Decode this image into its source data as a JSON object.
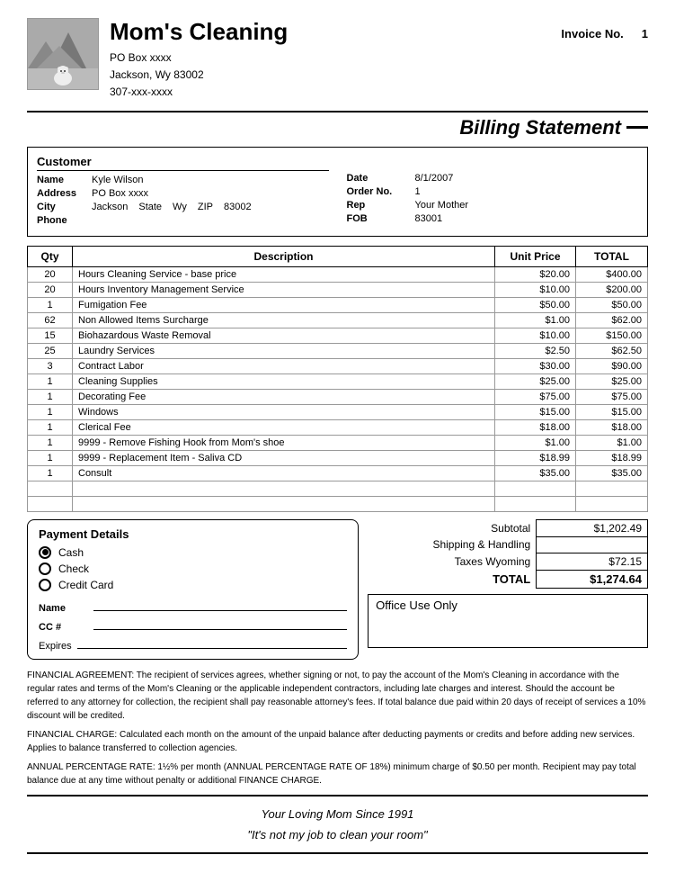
{
  "company": {
    "name": "Mom's Cleaning",
    "address_line1": "PO Box xxxx",
    "address_line2": "Jackson, Wy  83002",
    "phone": "307-xxx-xxxx"
  },
  "invoice": {
    "label": "Invoice No.",
    "number": "1"
  },
  "billing_statement_title": "Billing Statement",
  "customer": {
    "header": "Customer",
    "name_label": "Name",
    "name_value": "Kyle Wilson",
    "address_label": "Address",
    "address_value": "PO Box xxxx",
    "city_label": "City",
    "city_value": "Jackson",
    "state_label": "State",
    "state_value": "Wy",
    "zip_label": "ZIP",
    "zip_value": "83002",
    "phone_label": "Phone",
    "phone_value": ""
  },
  "order_info": {
    "date_label": "Date",
    "date_value": "8/1/2007",
    "order_label": "Order No.",
    "order_value": "1",
    "rep_label": "Rep",
    "rep_value": "Your Mother",
    "fob_label": "FOB",
    "fob_value": "83001"
  },
  "table": {
    "headers": [
      "Qty",
      "Description",
      "Unit Price",
      "TOTAL"
    ],
    "rows": [
      {
        "qty": "20",
        "desc": "Hours Cleaning Service - base price",
        "unit_price": "$20.00",
        "total": "$400.00"
      },
      {
        "qty": "20",
        "desc": "Hours Inventory Management Service",
        "unit_price": "$10.00",
        "total": "$200.00"
      },
      {
        "qty": "1",
        "desc": "Fumigation Fee",
        "unit_price": "$50.00",
        "total": "$50.00"
      },
      {
        "qty": "62",
        "desc": "Non Allowed Items Surcharge",
        "unit_price": "$1.00",
        "total": "$62.00"
      },
      {
        "qty": "15",
        "desc": "Biohazardous Waste Removal",
        "unit_price": "$10.00",
        "total": "$150.00"
      },
      {
        "qty": "25",
        "desc": "Laundry Services",
        "unit_price": "$2.50",
        "total": "$62.50"
      },
      {
        "qty": "3",
        "desc": "Contract Labor",
        "unit_price": "$30.00",
        "total": "$90.00"
      },
      {
        "qty": "1",
        "desc": "Cleaning Supplies",
        "unit_price": "$25.00",
        "total": "$25.00"
      },
      {
        "qty": "1",
        "desc": "Decorating Fee",
        "unit_price": "$75.00",
        "total": "$75.00"
      },
      {
        "qty": "1",
        "desc": "Windows",
        "unit_price": "$15.00",
        "total": "$15.00"
      },
      {
        "qty": "1",
        "desc": "Clerical Fee",
        "unit_price": "$18.00",
        "total": "$18.00"
      },
      {
        "qty": "1",
        "desc": "9999 - Remove Fishing Hook from Mom's shoe",
        "unit_price": "$1.00",
        "total": "$1.00"
      },
      {
        "qty": "1",
        "desc": "9999 - Replacement Item - Saliva CD",
        "unit_price": "$18.99",
        "total": "$18.99"
      },
      {
        "qty": "1",
        "desc": "Consult",
        "unit_price": "$35.00",
        "total": "$35.00"
      }
    ]
  },
  "payment": {
    "header": "Payment Details",
    "options": [
      "Cash",
      "Check",
      "Credit Card"
    ],
    "selected_index": 0,
    "name_label": "Name",
    "cc_label": "CC #",
    "expires_label": "Expires"
  },
  "totals": {
    "subtotal_label": "Subtotal",
    "subtotal_value": "$1,202.49",
    "shipping_label": "Shipping & Handling",
    "shipping_value": "",
    "taxes_label": "Taxes",
    "taxes_state": "Wyoming",
    "taxes_value": "$72.15",
    "total_label": "TOTAL",
    "total_value": "$1,274.64"
  },
  "office_use": {
    "label": "Office Use Only"
  },
  "fine_print": {
    "p1": "FINANCIAL AGREEMENT:  The recipient of services agrees, whether signing or not, to pay the account of the Mom's Cleaning in accordance with the regular rates and terms of the Mom's Cleaning or the applicable independent contractors, including late charges and interest.  Should the account be referred to any attorney for collection, the recipient shall pay reasonable attorney's fees. If total balance due paid within 20 days of receipt of services a 10% discount will be credited.",
    "p2": "FINANCIAL CHARGE:  Calculated each month on the amount of the unpaid balance after deducting payments or credits and before adding new services.  Applies to balance transferred to collection agencies.",
    "p3": "ANNUAL PERCENTAGE RATE: 1½% per month (ANNUAL PERCENTAGE RATE OF 18%) minimum charge of $0.50 per month. Recipient may pay total balance due at any time without penalty or additional FINANCE CHARGE."
  },
  "footer": {
    "line1": "Your Loving Mom Since 1991",
    "line2": "\"It's not my job to clean your room\""
  }
}
